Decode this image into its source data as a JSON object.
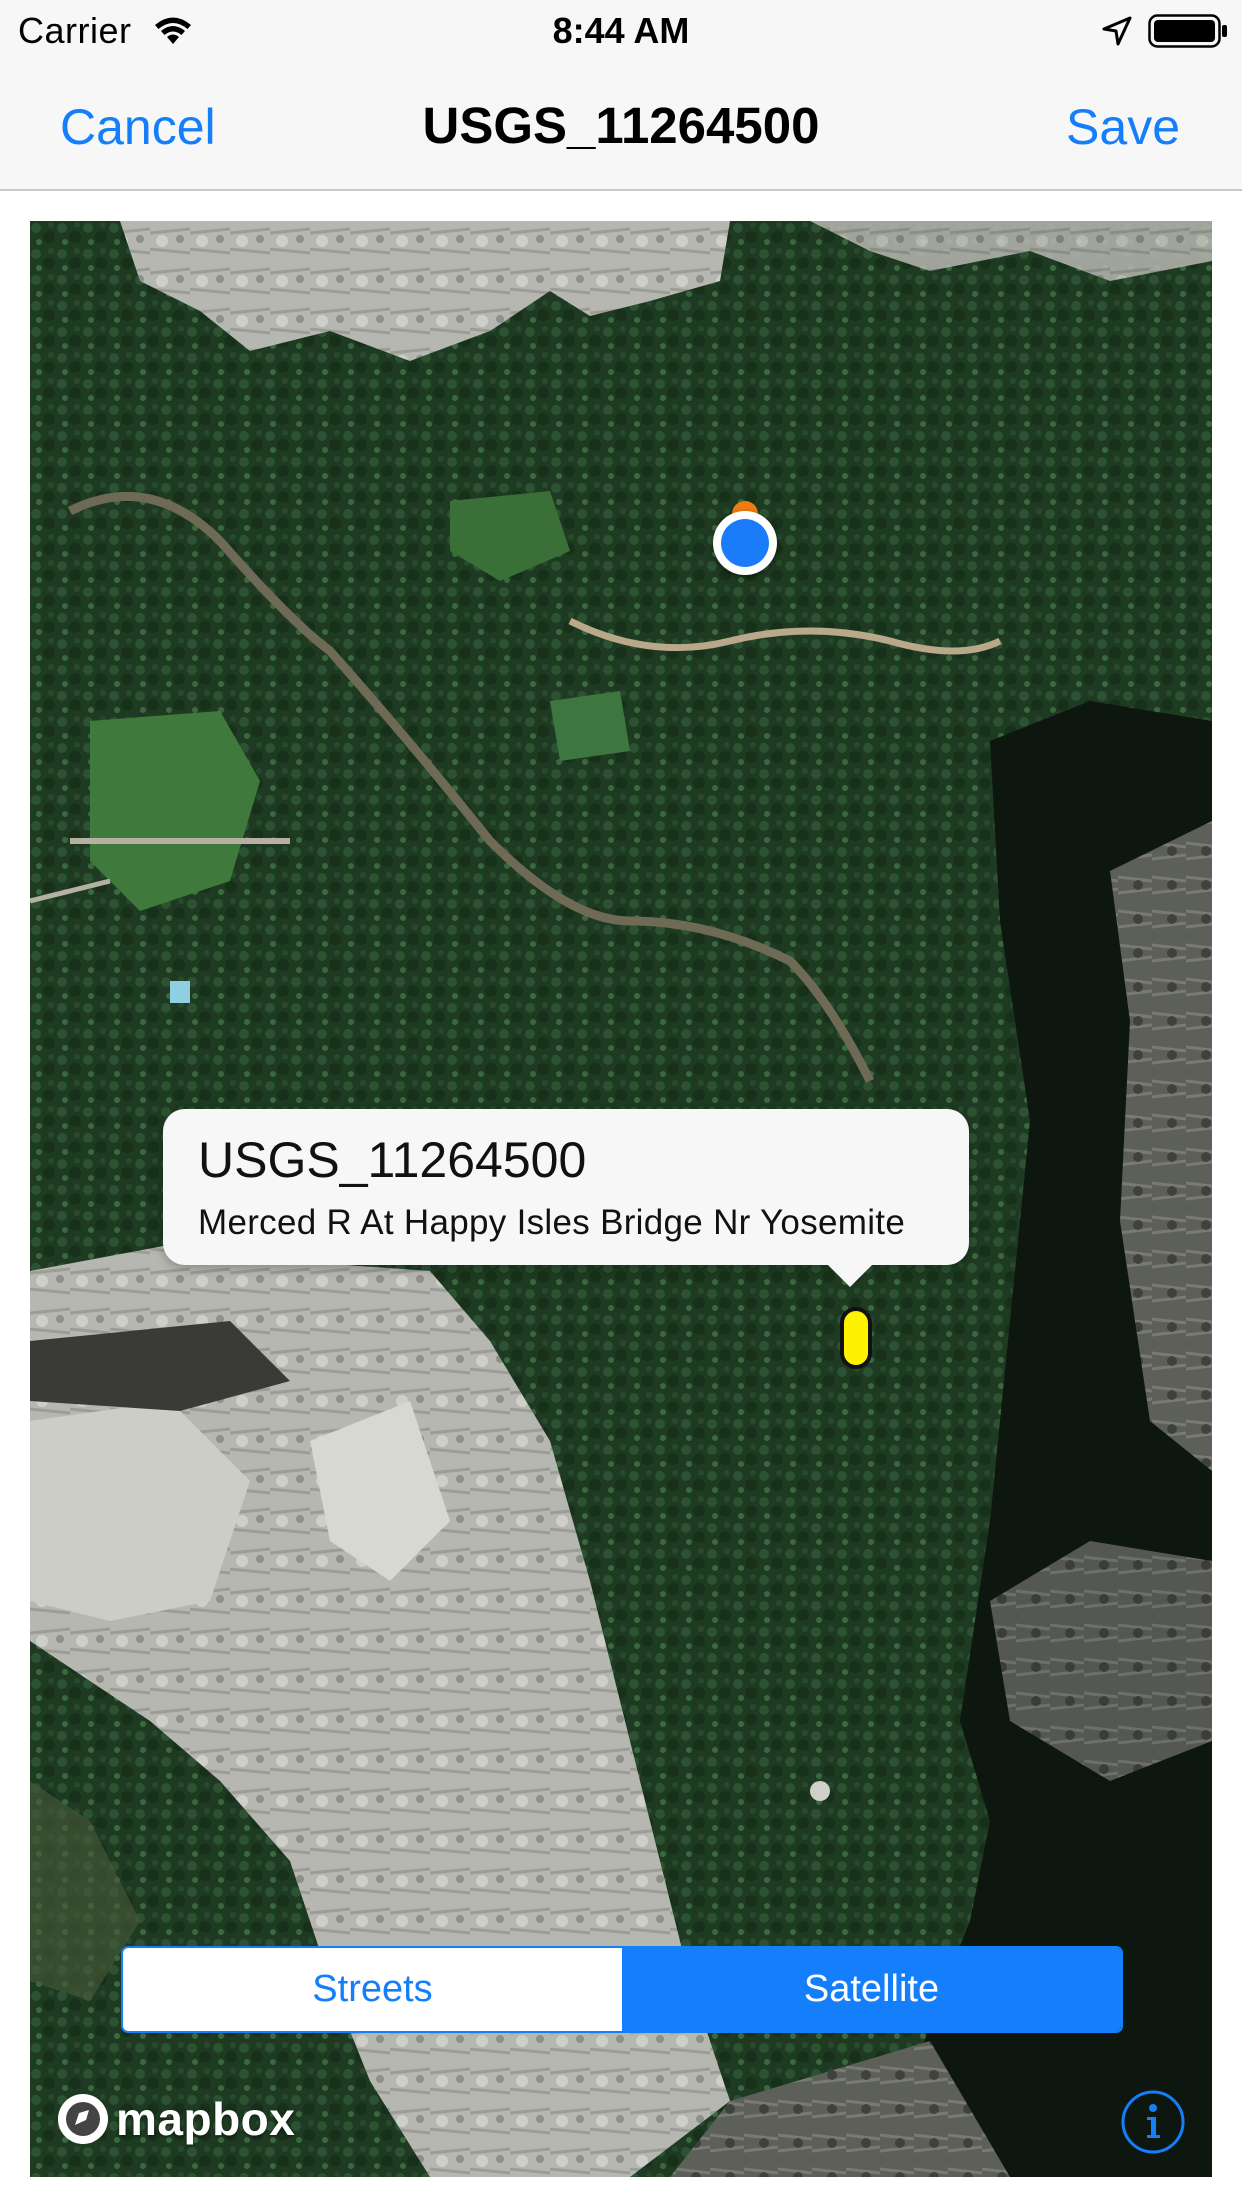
{
  "status_bar": {
    "carrier": "Carrier",
    "time": "8:44 AM",
    "icons": [
      "wifi-icon",
      "location-arrow-icon",
      "battery-icon"
    ]
  },
  "nav_bar": {
    "cancel_label": "Cancel",
    "title": "USGS_11264500",
    "save_label": "Save"
  },
  "map": {
    "callout": {
      "title": "USGS_11264500",
      "subtitle": "Merced R At Happy Isles Bridge Nr Yosemite"
    },
    "style_switch": {
      "options": [
        "Streets",
        "Satellite"
      ],
      "selected": "Satellite"
    },
    "attribution": {
      "logo_text": "mapbox",
      "info_icon": "info-icon"
    }
  },
  "colors": {
    "accent": "#147efb",
    "marker": "#fff200",
    "user_location": "#1a7cf8",
    "user_heading": "#f07d13"
  }
}
